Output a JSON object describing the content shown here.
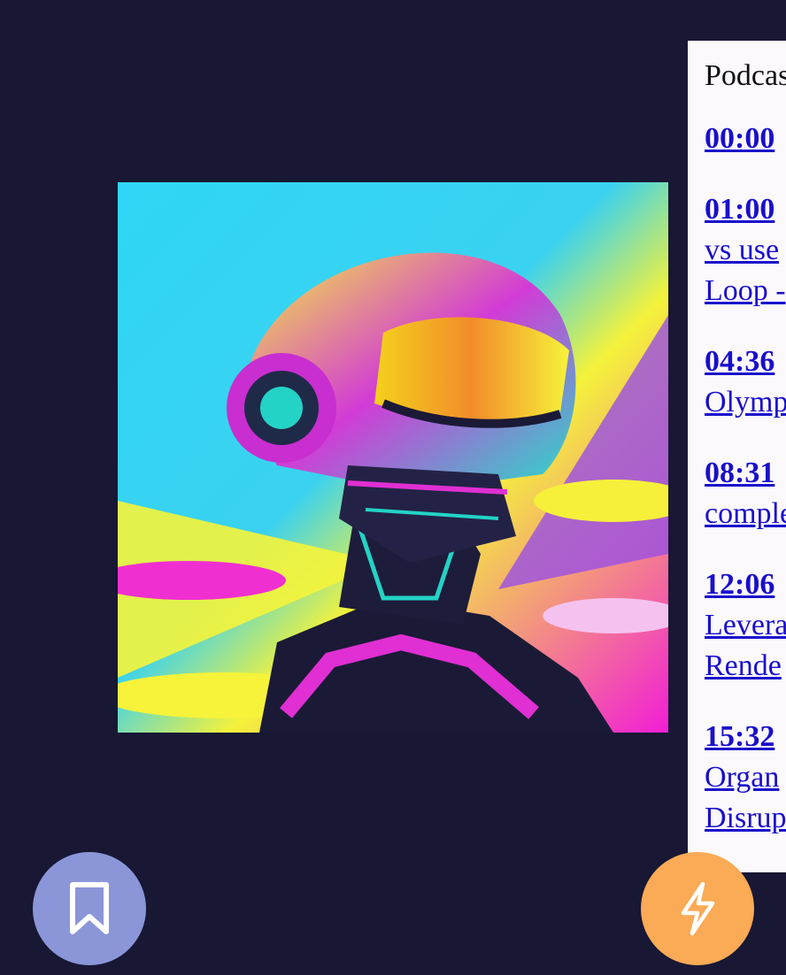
{
  "panel": {
    "title": "Podcas",
    "chapters": [
      {
        "time": "00:00",
        "lines": []
      },
      {
        "time": "01:00",
        "lines": [
          "vs use",
          "Loop -"
        ]
      },
      {
        "time": "04:36",
        "lines": [
          "Olymp"
        ]
      },
      {
        "time": "08:31",
        "lines": [
          "comple"
        ]
      },
      {
        "time": "12:06",
        "lines": [
          "Levera",
          "Rende"
        ]
      },
      {
        "time": "15:32",
        "lines": [
          "Organ",
          "Disrup"
        ]
      }
    ]
  },
  "actions": {
    "bookmark_icon": "bookmark-icon",
    "bolt_icon": "lightning-bolt-icon"
  },
  "colors": {
    "background": "#181734",
    "panel": "#fbf9fc",
    "link": "#1a0ecc",
    "bookmark_fab": "#8a96d8",
    "bolt_fab": "#fbaa55"
  }
}
